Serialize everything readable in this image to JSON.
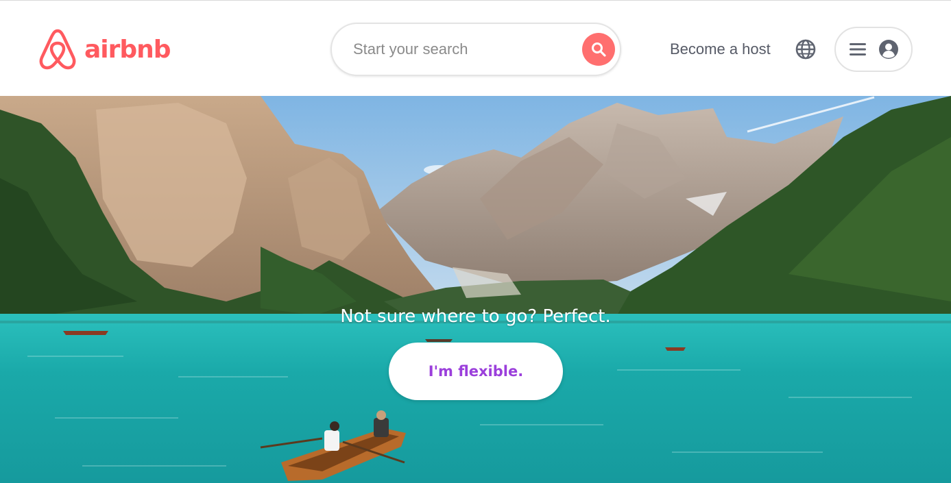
{
  "brand": {
    "name": "airbnb",
    "color": "#ff5a5f"
  },
  "header": {
    "search": {
      "placeholder": "Start your search",
      "value": "",
      "button_icon": "search-icon",
      "button_color": "#ff6f6f"
    },
    "host_link": "Become a host",
    "language_icon": "globe-icon",
    "user_menu": {
      "menu_icon": "hamburger-menu-icon",
      "profile_icon": "user-avatar-icon"
    }
  },
  "hero": {
    "image": "mountain-lake-with-rowboats",
    "headline": "Not sure where to go? Perfect.",
    "cta_label": "I'm flexible.",
    "cta_color": "#9b3fdb"
  }
}
